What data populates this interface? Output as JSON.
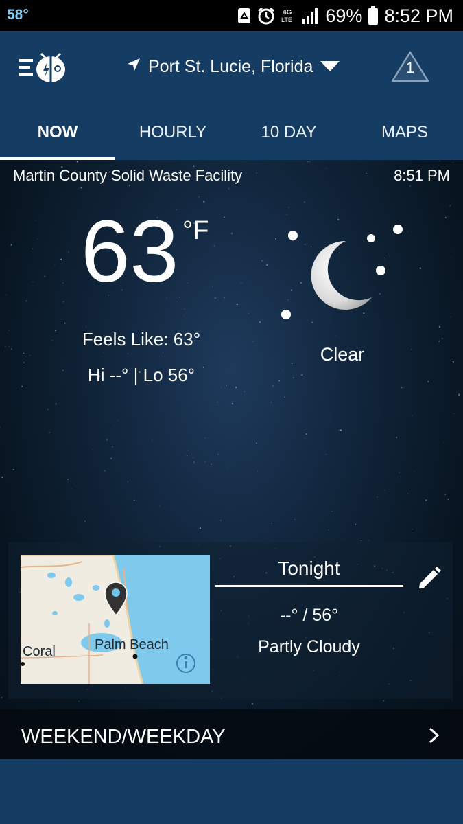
{
  "status_bar": {
    "outside_temp": "58°",
    "battery_percent": "69%",
    "time": "8:52 PM",
    "icons": [
      "recycle-notification-icon",
      "alarm-icon",
      "4g-lte-icon",
      "signal-icon",
      "battery-icon"
    ]
  },
  "header": {
    "location": "Port St. Lucie, Florida",
    "alert_count": "1",
    "icons": [
      "menu-icon",
      "weatherbug-logo",
      "location-arrow-icon",
      "dropdown-caret-icon",
      "alert-triangle-icon"
    ]
  },
  "tabs": [
    {
      "label": "NOW",
      "active": true
    },
    {
      "label": "HOURLY",
      "active": false
    },
    {
      "label": "10 DAY",
      "active": false
    },
    {
      "label": "MAPS",
      "active": false
    }
  ],
  "current": {
    "station": "Martin County Solid Waste Facility",
    "observed_time": "8:51 PM",
    "temperature": "63",
    "unit": "°F",
    "feels_like": "Feels Like: 63°",
    "hi_lo": "Hi --° | Lo 56°",
    "condition": "Clear",
    "condition_icon": "moon-stars-icon"
  },
  "forecast": {
    "period": "Tonight",
    "temps": "--° / 56°",
    "condition": "Partly Cloudy",
    "map_labels": [
      "Coral",
      "Palm Beach"
    ]
  },
  "section": {
    "title": "WEEKEND/WEEKDAY"
  },
  "colors": {
    "header_blue": "#153d63",
    "status_temp_blue": "#7fd0f4",
    "map_water": "#7fc9ec",
    "map_land": "#f1ece2"
  }
}
